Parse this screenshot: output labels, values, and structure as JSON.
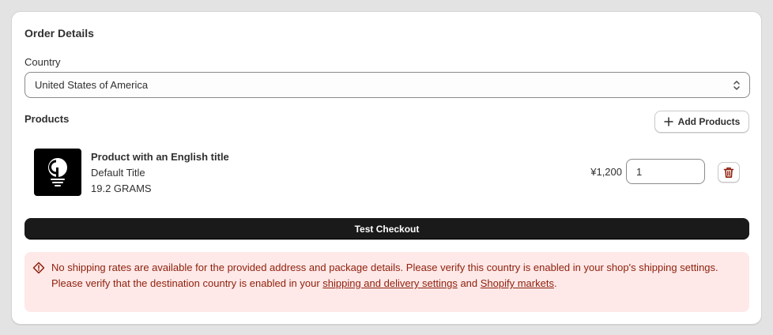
{
  "order": {
    "title": "Order Details",
    "country_label": "Country",
    "country_value": "United States of America",
    "products_label": "Products",
    "add_products_label": "Add Products"
  },
  "product": {
    "name": "Product with an English title",
    "variant": "Default Title",
    "weight": "19.2 GRAMS",
    "price": "¥1,200",
    "quantity": "1",
    "thumbnail_icon": "lightbulb-icon"
  },
  "checkout": {
    "label": "Test Checkout"
  },
  "banner": {
    "line1": "No shipping rates are available for the provided address and package details. Please verify this country is enabled in your shop's shipping settings.",
    "line2_prefix": "Please verify that the destination country is enabled in your ",
    "link1": "shipping and delivery settings",
    "middle": " and ",
    "link2": "Shopify markets",
    "suffix": "."
  },
  "colors": {
    "banner_bg": "#fee9e8",
    "banner_text": "#8e1f0b",
    "delete_icon": "#8e1f0b",
    "primary_button": "#1a1a1a"
  }
}
